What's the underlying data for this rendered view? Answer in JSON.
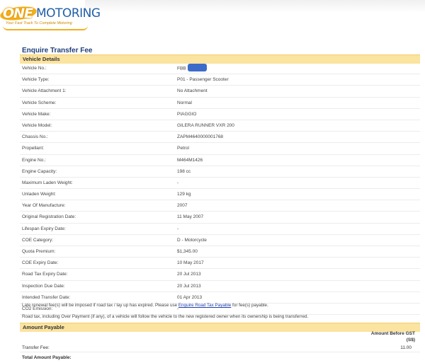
{
  "brand": {
    "logo_one": "ONE",
    "logo_motoring": "MOTORING",
    "tagline": "Your Fast Track To Complete Motoring"
  },
  "page_title": "Enquire Transfer Fee",
  "vehicle_section": {
    "heading": "Vehicle Details",
    "rows": [
      {
        "label": "Vehicle No.:",
        "value": "FBB"
      },
      {
        "label": "Vehicle Type:",
        "value": "P01 - Passenger Scooter"
      },
      {
        "label": "Vehicle Attachment 1:",
        "value": "No Attachment"
      },
      {
        "label": "Vehicle Scheme:",
        "value": "Normal"
      },
      {
        "label": "Vehicle Make:",
        "value": "PIAGGIO"
      },
      {
        "label": "Vehicle Model:",
        "value": "GILERA RUNNER VXR 200"
      },
      {
        "label": "Chassis No.:",
        "value": "ZAPM4640000001768"
      },
      {
        "label": "Propellant:",
        "value": "Petrol"
      },
      {
        "label": "Engine No.:",
        "value": "M464M1426"
      },
      {
        "label": "Engine Capacity:",
        "value": "198 cc"
      },
      {
        "label": "Maximum Laden Weight:",
        "value": "-"
      },
      {
        "label": "Unladen Weight:",
        "value": "129 kg"
      },
      {
        "label": "Year Of Manufacture:",
        "value": "2007"
      },
      {
        "label": "Original Registration Date:",
        "value": "11 May 2007"
      },
      {
        "label": "Lifespan Expiry Date:",
        "value": "-"
      },
      {
        "label": "COE Category:",
        "value": "D - Motorcycle"
      },
      {
        "label": "Quota Premium:",
        "value": "$1,345.00"
      },
      {
        "label": "COE Expiry Date:",
        "value": "10 May 2017"
      },
      {
        "label": "Road Tax Expiry Date:",
        "value": "20 Jul 2013"
      },
      {
        "label": "Inspection Due Date:",
        "value": "20 Jul 2013"
      },
      {
        "label": "Intended Transfer Date:",
        "value": "01 Apr 2013"
      },
      {
        "label": "CO2 Emission:",
        "value": "-"
      }
    ]
  },
  "notes": {
    "late_renewal_prefix": "Late renewal fee(s) will be imposed if road tax / lay up has expired. Please use ",
    "late_renewal_link": "Enguire Road Tax Payable",
    "late_renewal_suffix": " for fee(s) payable.",
    "road_tax": "Road tax, including Over Payment (if any), of a vehicle will follow the vehicle to the new registered owner when its ownership is being transferred."
  },
  "amount_section": {
    "heading": "Amount Payable",
    "column_header_line1": "Amount Before GST",
    "column_header_line2": "(S$)",
    "transfer_fee_label": "Transfer Fee:",
    "transfer_fee_value": "11.00",
    "total_label": "Total Amount Payable:"
  },
  "colors": {
    "section_bar": "#fbe3a0",
    "title": "#1f3f7a",
    "link": "#1e3ea8",
    "redaction": "#3d6bc9"
  }
}
